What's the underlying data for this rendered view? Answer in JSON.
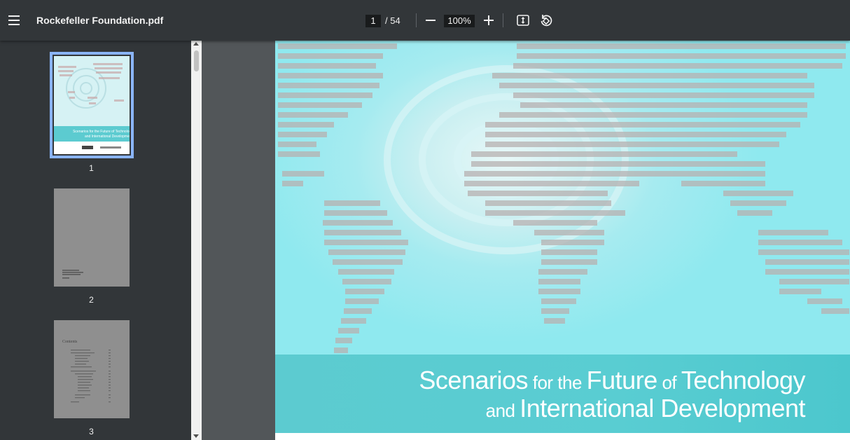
{
  "toolbar": {
    "title": "Rockefeller Foundation.pdf",
    "current_page": "1",
    "total_pages": "/ 54",
    "zoom": "100%"
  },
  "thumbnails": [
    {
      "label": "1"
    },
    {
      "label": "2"
    },
    {
      "label": "3"
    }
  ],
  "thumbnail_texts": {
    "cover_title": "Scenarios for the Future of Technology and International Development",
    "contents_heading": "Contents"
  },
  "cover": {
    "line1_a": "Scenarios",
    "line1_b": " for the ",
    "line1_c": "Future",
    "line1_d": " of ",
    "line1_e": "Technology",
    "line2_a": "and ",
    "line2_b": "International Development"
  },
  "colors": {
    "toolbar": "#323639",
    "viewer_bg": "#525659",
    "selected_outline": "#8ab4f8",
    "banner": "#59cdd2"
  }
}
